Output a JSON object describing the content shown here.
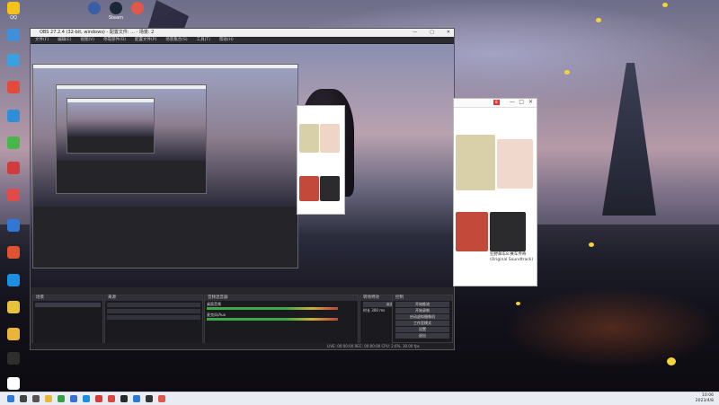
{
  "desktop_icons": [
    {
      "label": "QQ",
      "color": "#f4c21b"
    },
    {
      "label": "",
      "color": "#3f8fd9"
    },
    {
      "label": "",
      "color": "#3aa0e0"
    },
    {
      "label": "",
      "color": "#e24b3c"
    },
    {
      "label": "",
      "color": "#2f8ed8"
    },
    {
      "label": "",
      "color": "#49b649"
    },
    {
      "label": "",
      "color": "#d13b3b"
    },
    {
      "label": "",
      "color": "#e14a4a"
    },
    {
      "label": "",
      "color": "#3178d6"
    },
    {
      "label": "",
      "color": "#e05332"
    },
    {
      "label": "",
      "color": "#1b8fe0"
    },
    {
      "label": "",
      "color": "#e8c23a"
    },
    {
      "label": "",
      "color": "#e8b43a"
    },
    {
      "label": "",
      "color": "#2e2e2e"
    },
    {
      "label": "",
      "color": "#ffffff"
    }
  ],
  "top_icons": [
    {
      "label": "",
      "color": "#3a5ea8"
    },
    {
      "label": "Steam",
      "color": "#1b2838"
    },
    {
      "label": "",
      "color": "#e0584a"
    }
  ],
  "obs": {
    "title": "OBS 27.2.4 (32-bit, windows) - 配置文件: ... - 场景: 2",
    "menu": [
      "文件(F)",
      "编辑(E)",
      "视图(V)",
      "停靠部件(D)",
      "配置文件(P)",
      "场景集合(S)",
      "工具(T)",
      "帮助(H)"
    ],
    "docks": {
      "scenes": "场景",
      "sources": "来源",
      "mixer": "音频混音器",
      "transitions": "转场特效",
      "controls": "控制"
    },
    "mixer_tracks": [
      "桌面音频",
      "麦克风/Aux"
    ],
    "control_buttons": [
      "开始推流",
      "开始录制",
      "启动虚拟摄像机",
      "工作室模式",
      "设置",
      "退出"
    ],
    "transition_value": "淡出",
    "duration_label": "时长",
    "duration_value": "300 ms",
    "status_text": "LIVE: 00:00:00   REC: 00:00:00   CPU: 2.6%, 30.00 fps"
  },
  "player": {
    "items": [
      {
        "caption": "",
        "color": "#d9cfa8"
      },
      {
        "caption": "",
        "color": "#f0d8cc"
      },
      {
        "caption": "",
        "color": "#c34a3a"
      },
      {
        "caption": "狂野飙车8:赛车传奇",
        "color": "#2b2b2e"
      }
    ],
    "caption_sub": "(Original Soundtrack)",
    "badge": "8"
  },
  "taskbar": {
    "icons": [
      {
        "name": "start",
        "color": "#2a7ad6"
      },
      {
        "name": "search",
        "color": "#444444"
      },
      {
        "name": "taskview",
        "color": "#555555"
      },
      {
        "name": "explorer",
        "color": "#e7b83a"
      },
      {
        "name": "chrome",
        "color": "#3a9d4a"
      },
      {
        "name": "store",
        "color": "#3a6fd6"
      },
      {
        "name": "app1",
        "color": "#1b8fe0"
      },
      {
        "name": "app2",
        "color": "#d63a3a"
      },
      {
        "name": "app3",
        "color": "#d9463a"
      },
      {
        "name": "app4",
        "color": "#2a2a2a"
      },
      {
        "name": "app5",
        "color": "#2a7ad6"
      },
      {
        "name": "app6",
        "color": "#333333"
      },
      {
        "name": "app7",
        "color": "#e0584a"
      }
    ],
    "time": "10:06",
    "date": "2023/4/8"
  }
}
